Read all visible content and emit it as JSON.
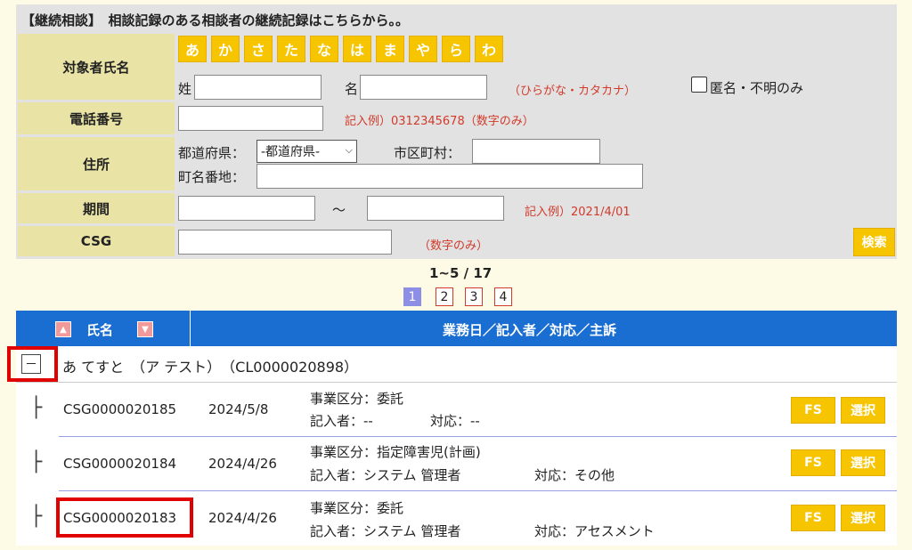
{
  "search": {
    "panel_title": "【継続相談】　相談記録のある相談者の継続記録はこちらから。。",
    "kana_buttons": [
      "あ",
      "か",
      "さ",
      "た",
      "な",
      "は",
      "ま",
      "や",
      "ら",
      "わ"
    ],
    "subject": {
      "label": "対象者氏名",
      "surname_label": "姓",
      "name_label": "名",
      "hint": "（ひらがな・カタカナ）",
      "anonymous_label": "匿名・不明のみ",
      "surname_value": "",
      "name_value": ""
    },
    "phone": {
      "label": "電話番号",
      "hint": "記入例）0312345678（数字のみ）",
      "value": ""
    },
    "address": {
      "label": "住所",
      "prefecture_label": "都道府県：",
      "prefecture_selected": "-都道府県-",
      "city_label": "市区町村：",
      "town_label": "町名番地："
    },
    "period": {
      "label": "期間",
      "separator": "～",
      "hint": "記入例）2021/4/01"
    },
    "csg": {
      "label": "CSG",
      "hint": "（数字のみ）"
    },
    "search_button": "検索"
  },
  "pagination": {
    "summary": "1~5 / 17",
    "pages": [
      "1",
      "2",
      "3",
      "4"
    ],
    "current": "1"
  },
  "table": {
    "header_name": "氏名",
    "header_detail": "業務日／記入者／対応／主訴",
    "sort_up": "▲",
    "sort_down": "▼",
    "group": {
      "toggle": "－",
      "name": "あ てすと　（ア テスト）　（CL0000020898）"
    },
    "records": [
      {
        "tree": "├",
        "id": "CSG0000020185",
        "date": "2024/5/8",
        "biz": "事業区分：委託",
        "writer": "記入者：--",
        "response": "対応：--",
        "fs": "FS",
        "select": "選択"
      },
      {
        "tree": "├",
        "id": "CSG0000020184",
        "date": "2024/4/26",
        "biz": "事業区分：指定障害児(計画)",
        "writer": "記入者：システム 管理者",
        "response": "対応：その他",
        "fs": "FS",
        "select": "選択"
      },
      {
        "tree": "├",
        "id": "CSG0000020183",
        "date": "2024/4/26",
        "biz": "事業区分：委託",
        "writer": "記入者：システム 管理者",
        "response": "対応：アセスメント",
        "fs": "FS",
        "select": "選択"
      }
    ]
  },
  "colors": {
    "accent_yellow": "#f7c400",
    "header_blue": "#1b6ed1",
    "label_bg": "#e9e4a6",
    "hint_red": "#d23a2a",
    "highlight_red": "#e00000"
  }
}
